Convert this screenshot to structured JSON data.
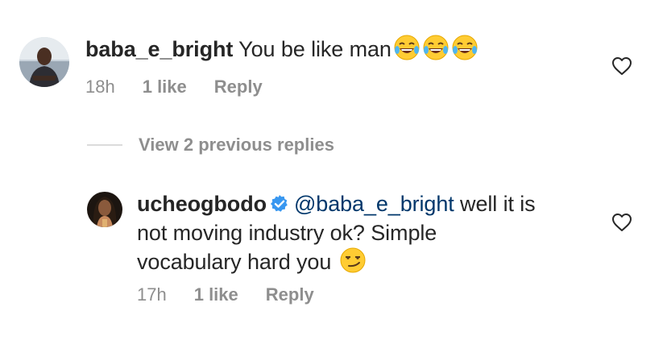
{
  "comments": [
    {
      "username": "baba_e_bright",
      "text": "You be like man",
      "emojis": [
        "face-with-tears-of-joy-icon",
        "face-with-tears-of-joy-icon",
        "face-with-tears-of-joy-icon"
      ],
      "time": "18h",
      "likes": "1 like",
      "reply_label": "Reply"
    }
  ],
  "view_replies": {
    "label": "View 2 previous replies"
  },
  "reply": {
    "username": "ucheogbodo",
    "verified": true,
    "mention": "@baba_e_bright",
    "line1": " well it is",
    "line2": "not moving industry ok? Simple",
    "line3": "vocabulary hard you",
    "emoji": "smirking-face-icon",
    "time": "17h",
    "likes": "1 like",
    "reply_label": "Reply"
  },
  "colors": {
    "text": "#262626",
    "secondary": "#8e8e8e",
    "verified": "#3897f0",
    "mention": "#00376b"
  }
}
